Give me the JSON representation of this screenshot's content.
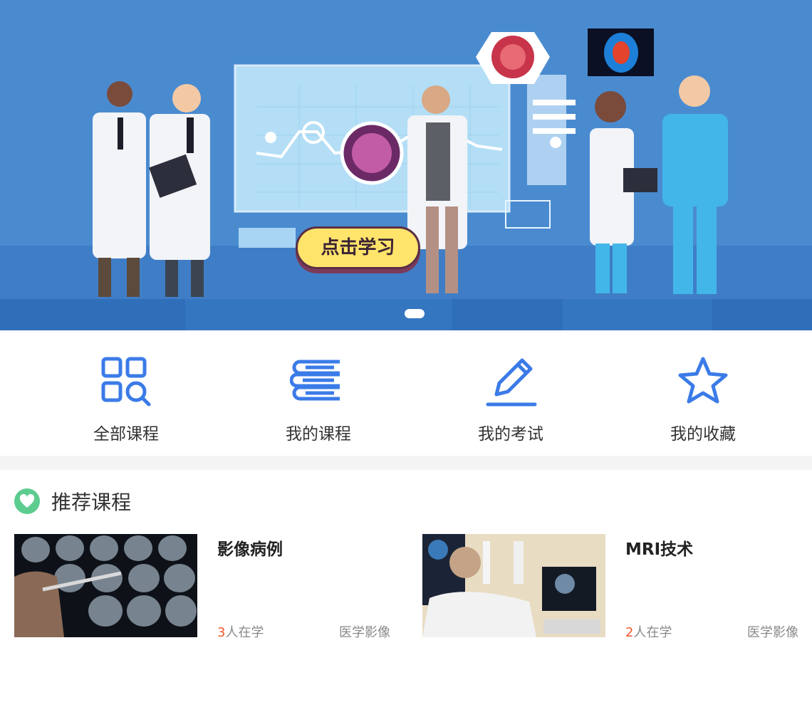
{
  "banner": {
    "cta_label": "点击学习",
    "slides_count": 1,
    "active_slide": 1
  },
  "quick_nav": [
    {
      "label": "全部课程",
      "icon": "grid-search-icon"
    },
    {
      "label": "我的课程",
      "icon": "books-icon"
    },
    {
      "label": "我的考试",
      "icon": "pencil-icon"
    },
    {
      "label": "我的收藏",
      "icon": "star-icon"
    }
  ],
  "recommended": {
    "title": "推荐课程",
    "icon": "heart-icon",
    "courses": [
      {
        "title": "影像病例",
        "learners": "3",
        "learners_suffix": "人在学",
        "category": "医学影像"
      },
      {
        "title": "MRI技术",
        "learners": "2",
        "learners_suffix": "人在学",
        "category": "医学影像"
      }
    ]
  },
  "colors": {
    "accent": "#3b7be8",
    "banner_bg": "#4a8bd0",
    "heart_green": "#5dcc8f",
    "count_orange": "#f25a2c"
  }
}
